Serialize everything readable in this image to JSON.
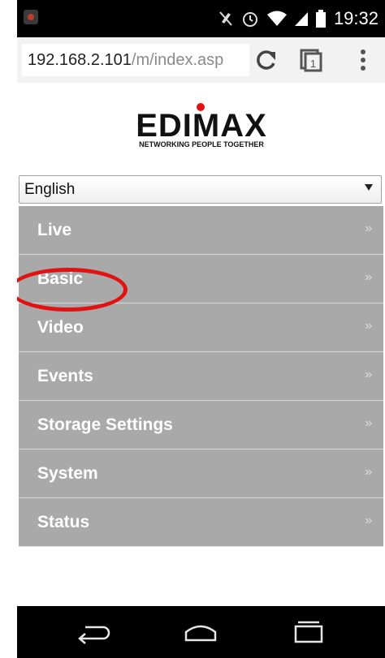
{
  "status_bar": {
    "time": "19:32",
    "icons": [
      "notification-icon",
      "mute-icon",
      "alarm-icon",
      "wifi-icon",
      "signal-icon",
      "battery-icon"
    ]
  },
  "browser": {
    "url_host": "192.168.2.101",
    "url_path": "/m/index.asp",
    "tab_count": "1",
    "icons": [
      "reload-icon",
      "tabs-icon",
      "overflow-menu-icon"
    ]
  },
  "logo": {
    "brand": "EDIMAX",
    "tagline": "NETWORKING PEOPLE TOGETHER",
    "accent_color": "#e31212"
  },
  "language_select": {
    "selected": "English"
  },
  "menu": {
    "items": [
      {
        "label": "Live",
        "chevron": "»"
      },
      {
        "label": "Basic",
        "chevron": "»"
      },
      {
        "label": "Video",
        "chevron": "»"
      },
      {
        "label": "Events",
        "chevron": "»"
      },
      {
        "label": "Storage Settings",
        "chevron": "»"
      },
      {
        "label": "System",
        "chevron": "»"
      },
      {
        "label": "Status",
        "chevron": "»"
      }
    ],
    "highlighted": "Basic",
    "highlight_color": "#e31212"
  },
  "nav_bar": {
    "icons": [
      "back-icon",
      "home-icon",
      "recents-icon"
    ]
  },
  "colors": {
    "menu_bg": "#a9a9a9",
    "menu_text": "#ffffff",
    "status_bar_bg": "#000000"
  }
}
